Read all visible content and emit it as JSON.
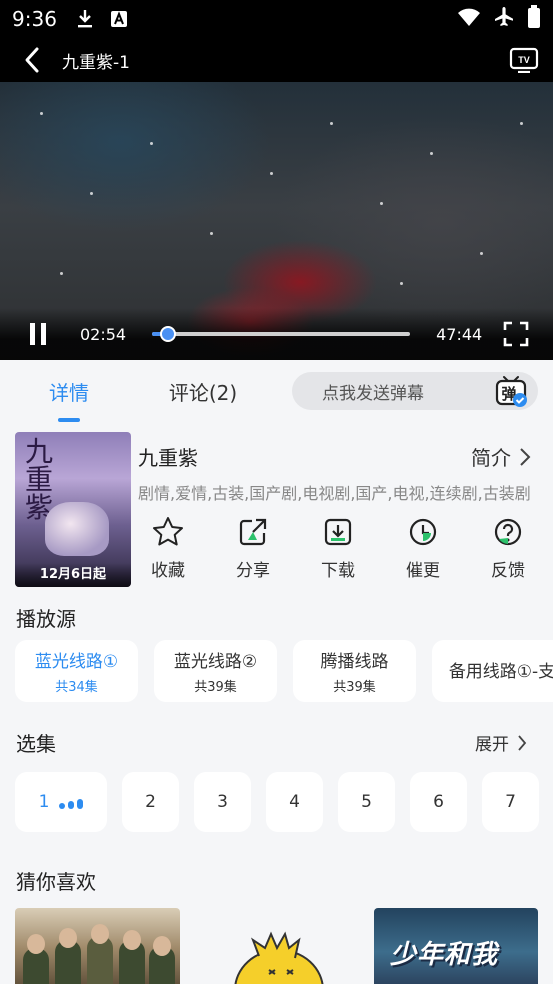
{
  "status_bar": {
    "time": "9:36",
    "left_icons": [
      "download-icon",
      "a-badge-icon"
    ],
    "right_icons": [
      "wifi-icon",
      "airplane-icon",
      "battery-icon"
    ]
  },
  "player": {
    "title": "九重紫-1",
    "current_time": "02:54",
    "duration": "47:44",
    "progress": 0.061,
    "accent": "#4a90f2"
  },
  "tabs": [
    {
      "label": "详情",
      "active": true
    },
    {
      "label": "评论(2)",
      "active": false
    }
  ],
  "danmu": {
    "placeholder": "点我发送弹幕",
    "icon_text": "弹"
  },
  "show": {
    "name": "九重紫",
    "intro_label": "简介",
    "genres": "剧情,爱情,古装,国产剧,电视剧,国产,电视,连续剧,古装剧",
    "poster": {
      "title": "九重紫",
      "date": "12月6日起"
    }
  },
  "actions": [
    {
      "label": "收藏",
      "icon": "star-icon"
    },
    {
      "label": "分享",
      "icon": "share-icon"
    },
    {
      "label": "下载",
      "icon": "download-icon"
    },
    {
      "label": "催更",
      "icon": "clock-icon"
    },
    {
      "label": "反馈",
      "icon": "question-icon"
    }
  ],
  "sources": {
    "title": "播放源",
    "items": [
      {
        "name": "蓝光线路①",
        "count": "共34集",
        "active": true
      },
      {
        "name": "蓝光线路②",
        "count": "共39集",
        "active": false
      },
      {
        "name": "腾播线路",
        "count": "共39集",
        "active": false
      },
      {
        "name": "备用线路①-支",
        "count": "",
        "active": false
      }
    ]
  },
  "episodes": {
    "title": "选集",
    "expand_label": "展开",
    "items": [
      "1",
      "2",
      "3",
      "4",
      "5",
      "6",
      "7"
    ]
  },
  "recommend": {
    "title": "猜你喜欢",
    "items": [
      {
        "title": ""
      },
      {
        "title": ""
      },
      {
        "title": "少年和我"
      }
    ]
  },
  "colors": {
    "accent": "#2d8cf0",
    "background": "#f5f6f8",
    "card": "#ffffff"
  }
}
